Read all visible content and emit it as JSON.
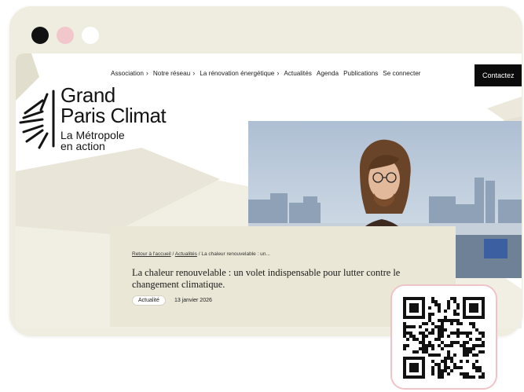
{
  "nav": {
    "items": [
      {
        "label": "Association",
        "has_chevron": true
      },
      {
        "label": "Notre réseau",
        "has_chevron": true
      },
      {
        "label": "La rénovation énergétique",
        "has_chevron": true
      },
      {
        "label": "Actualités",
        "has_chevron": false
      },
      {
        "label": "Agenda",
        "has_chevron": false
      },
      {
        "label": "Publications",
        "has_chevron": false
      },
      {
        "label": "Se connecter",
        "has_chevron": false
      }
    ],
    "cta": "Contactez"
  },
  "logo": {
    "line1": "Grand",
    "line2": "Paris Climat",
    "tag1": "La Métropole",
    "tag2": "en action"
  },
  "article": {
    "breadcrumb": {
      "home": "Retour à l'accueil",
      "section": "Actualités",
      "current": "La chaleur renouvelable : un..."
    },
    "title": "La chaleur renouvelable : un volet indispensable pour lutter contre le changement climatique.",
    "tag": "Actualité",
    "date": "13 janvier 2026"
  },
  "colors": {
    "window": "#efece0",
    "card": "#ebe7d6",
    "accent_pink": "#f0c3c8",
    "cta_bg": "#0b0b0b"
  }
}
